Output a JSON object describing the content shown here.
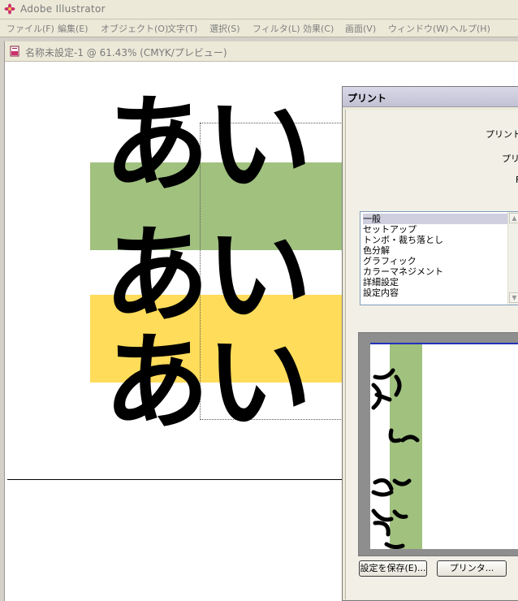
{
  "app": {
    "title": "Adobe Illustrator",
    "icon": "illustrator-flower-icon"
  },
  "menu": [
    "ファイル(F)",
    "編集(E)",
    "オブジェクト(O)",
    "文字(T)",
    "選択(S)",
    "フィルタ(L)",
    "効果(C)",
    "画面(V)",
    "ウィンドウ(W)",
    "ヘルプ(H)"
  ],
  "document": {
    "title": "名称未設定-1 @ 61.43% (CMYK/プレビュー)",
    "lines": [
      "あい",
      "あい",
      "あい"
    ],
    "band_colors": {
      "green": "#a1c17f",
      "yellow": "#ffdc5a"
    }
  },
  "print_dialog": {
    "title": "プリント",
    "labels": [
      "プリント設",
      "プリ",
      "F"
    ],
    "categories": [
      "一般",
      "セットアップ",
      "トンボ・裁ち落とし",
      "色分解",
      "グラフィック",
      "カラーマネジメント",
      "詳細設定",
      "設定内容"
    ],
    "selected_category": "一般",
    "buttons": {
      "save_settings": "設定を保存(E)...",
      "printer": "プリンタ..."
    }
  }
}
